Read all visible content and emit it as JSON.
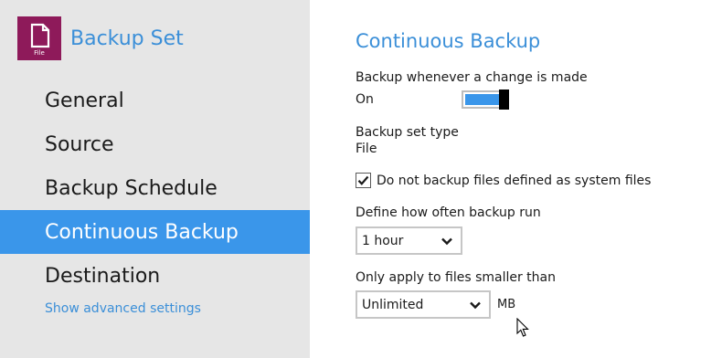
{
  "sidebar": {
    "app_title": "Backup Set",
    "file_icon_label": "File",
    "items": [
      {
        "label": "General"
      },
      {
        "label": "Source"
      },
      {
        "label": "Backup Schedule"
      },
      {
        "label": "Continuous Backup"
      },
      {
        "label": "Destination"
      }
    ],
    "active_item": "Continuous Backup",
    "advanced_link": "Show advanced settings"
  },
  "main": {
    "title": "Continuous Backup",
    "change_label": "Backup whenever a change is made",
    "toggle_state": "On",
    "toggle_on": true,
    "set_type_label": "Backup set type",
    "set_type_value": "File",
    "system_files_label": "Do not backup files defined as system files",
    "system_files_checked": true,
    "frequency_label": "Define how often backup run",
    "frequency_value": "1 hour",
    "size_label": "Only apply to files smaller than",
    "size_value": "Unlimited",
    "size_unit": "MB"
  },
  "colors": {
    "accent": "#3a96ea",
    "title_blue": "#3b8fd8",
    "sidebar_bg": "#e6e6e6",
    "file_icon_bg": "#8e1a5a"
  },
  "icons": {
    "app": "file-icon",
    "select": "chevron-down-icon",
    "check": "check-icon",
    "pointer": "mouse-pointer-icon"
  }
}
